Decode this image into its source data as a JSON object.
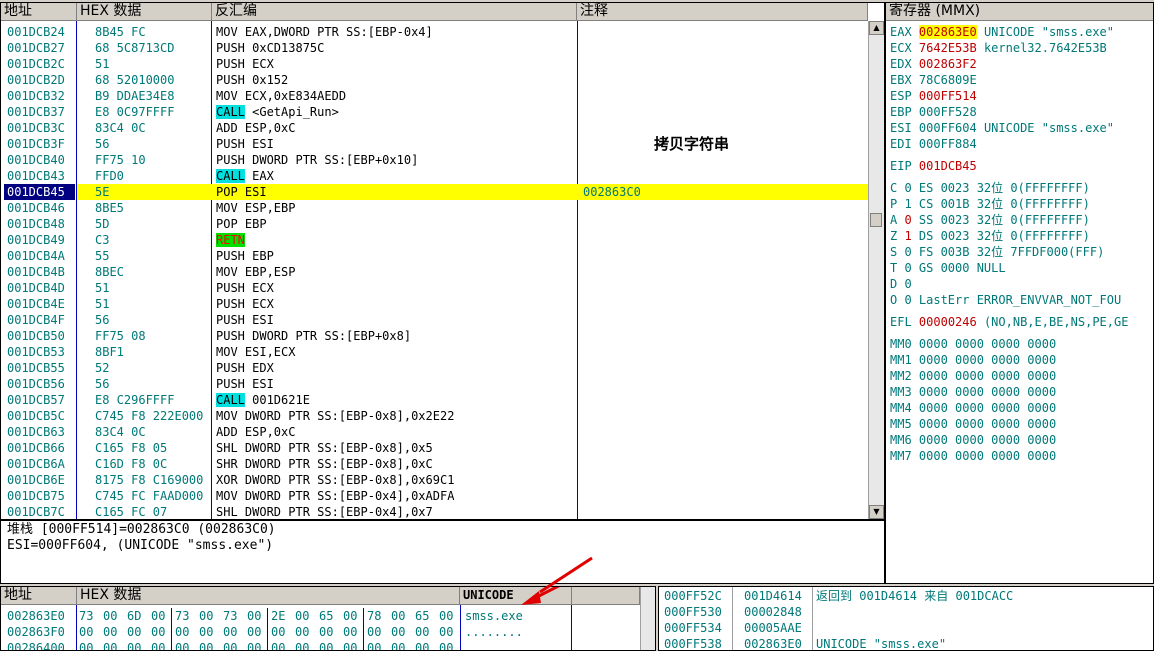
{
  "disasm": {
    "headers": {
      "address": "地址",
      "hex": "HEX 数据",
      "disasm": "反汇编",
      "comment": "注释"
    },
    "annotation": "拷贝字符串",
    "rows": [
      {
        "addr": "001DCB24",
        "hex": "8B45 FC",
        "asm": "MOV EAX,DWORD PTR SS:[EBP-0x4]",
        "comment": ""
      },
      {
        "addr": "001DCB27",
        "hex": "68 5C8713CD",
        "asm": "PUSH 0xCD13875C",
        "comment": ""
      },
      {
        "addr": "001DCB2C",
        "hex": "51",
        "asm": "PUSH ECX",
        "comment": ""
      },
      {
        "addr": "001DCB2D",
        "hex": "68 52010000",
        "asm": "PUSH 0x152",
        "comment": ""
      },
      {
        "addr": "001DCB32",
        "hex": "B9 DDAE34E8",
        "asm": "MOV ECX,0xE834AEDD",
        "comment": ""
      },
      {
        "addr": "001DCB37",
        "hex": "E8 0C97FFFF",
        "op": "CALL",
        "asm": " <GetApi_Run>",
        "kind": "call",
        "comment": ""
      },
      {
        "addr": "001DCB3C",
        "hex": "83C4 0C",
        "asm": "ADD ESP,0xC",
        "comment": ""
      },
      {
        "addr": "001DCB3F",
        "hex": "56",
        "asm": "PUSH ESI",
        "comment": ""
      },
      {
        "addr": "001DCB40",
        "hex": "FF75 10",
        "asm": "PUSH DWORD PTR SS:[EBP+0x10]",
        "comment": ""
      },
      {
        "addr": "001DCB43",
        "hex": "FFD0",
        "op": "CALL",
        "asm": " EAX",
        "kind": "call",
        "comment": ""
      },
      {
        "addr": "001DCB45",
        "hex": "5E",
        "asm": "POP ESI",
        "comment": "002863C0",
        "selected": true
      },
      {
        "addr": "001DCB46",
        "hex": "8BE5",
        "asm": "MOV ESP,EBP",
        "comment": ""
      },
      {
        "addr": "001DCB48",
        "hex": "5D",
        "asm": "POP EBP",
        "comment": ""
      },
      {
        "addr": "001DCB49",
        "hex": "C3",
        "op": "RETN",
        "asm": "",
        "kind": "retn",
        "comment": ""
      },
      {
        "addr": "001DCB4A",
        "hex": "55",
        "asm": "PUSH EBP",
        "comment": ""
      },
      {
        "addr": "001DCB4B",
        "hex": "8BEC",
        "asm": "MOV EBP,ESP",
        "comment": ""
      },
      {
        "addr": "001DCB4D",
        "hex": "51",
        "asm": "PUSH ECX",
        "comment": ""
      },
      {
        "addr": "001DCB4E",
        "hex": "51",
        "asm": "PUSH ECX",
        "comment": ""
      },
      {
        "addr": "001DCB4F",
        "hex": "56",
        "asm": "PUSH ESI",
        "comment": ""
      },
      {
        "addr": "001DCB50",
        "hex": "FF75 08",
        "asm": "PUSH DWORD PTR SS:[EBP+0x8]",
        "comment": ""
      },
      {
        "addr": "001DCB53",
        "hex": "8BF1",
        "asm": "MOV ESI,ECX",
        "comment": ""
      },
      {
        "addr": "001DCB55",
        "hex": "52",
        "asm": "PUSH EDX",
        "comment": ""
      },
      {
        "addr": "001DCB56",
        "hex": "56",
        "asm": "PUSH ESI",
        "comment": ""
      },
      {
        "addr": "001DCB57",
        "hex": "E8 C296FFFF",
        "op": "CALL",
        "asm": " 001D621E",
        "kind": "call",
        "comment": ""
      },
      {
        "addr": "001DCB5C",
        "hex": "C745 F8 222E000",
        "asm": "MOV DWORD PTR SS:[EBP-0x8],0x2E22",
        "comment": ""
      },
      {
        "addr": "001DCB63",
        "hex": "83C4 0C",
        "asm": "ADD ESP,0xC",
        "comment": ""
      },
      {
        "addr": "001DCB66",
        "hex": "C165 F8 05",
        "asm": "SHL DWORD PTR SS:[EBP-0x8],0x5",
        "comment": ""
      },
      {
        "addr": "001DCB6A",
        "hex": "C16D F8 0C",
        "asm": "SHR DWORD PTR SS:[EBP-0x8],0xC",
        "comment": ""
      },
      {
        "addr": "001DCB6E",
        "hex": "8175 F8 C169000",
        "asm": "XOR DWORD PTR SS:[EBP-0x8],0x69C1",
        "comment": ""
      },
      {
        "addr": "001DCB75",
        "hex": "C745 FC FAAD000",
        "asm": "MOV DWORD PTR SS:[EBP-0x4],0xADFA",
        "comment": ""
      },
      {
        "addr": "001DCB7C",
        "hex": "C165 FC 07",
        "asm": "SHL DWORD PTR SS:[EBP-0x4],0x7",
        "comment": ""
      }
    ]
  },
  "info": {
    "line1": "堆栈 [000FF514]=002863C0 (002863C0)",
    "line2": "ESI=000FF604, (UNICODE \"smss.exe\")"
  },
  "registers": {
    "title": "寄存器 (MMX)",
    "lines": [
      {
        "name": "EAX",
        "val": "002863E0",
        "rest": "UNICODE \"smss.exe\"",
        "hl": true
      },
      {
        "name": "ECX",
        "val": "7642E53B",
        "rest": "kernel32.7642E53B",
        "red": true
      },
      {
        "name": "EDX",
        "val": "002863F2",
        "rest": "",
        "red": true
      },
      {
        "name": "EBX",
        "val": "78C6809E",
        "rest": ""
      },
      {
        "name": "ESP",
        "val": "000FF514",
        "rest": "",
        "red": true
      },
      {
        "name": "EBP",
        "val": "000FF528",
        "rest": ""
      },
      {
        "name": "ESI",
        "val": "000FF604",
        "rest": "UNICODE \"smss.exe\""
      },
      {
        "name": "EDI",
        "val": "000FF884",
        "rest": ""
      },
      {
        "gap": true
      },
      {
        "name": "EIP",
        "val": "001DCB45",
        "rest": "",
        "red": true
      },
      {
        "gap": true
      },
      {
        "text": "C 0  ES 0023 32位  0(FFFFFFFF)"
      },
      {
        "text": "P 1  CS 001B 32位  0(FFFFFFFF)"
      },
      {
        "flag": "A",
        "fv": "0",
        "text": "  SS 0023 32位  0(FFFFFFFF)"
      },
      {
        "flag": "Z",
        "fv": "1",
        "text": "  DS 0023 32位  0(FFFFFFFF)"
      },
      {
        "text": "S 0  FS 003B 32位  7FFDF000(FFF)"
      },
      {
        "text": "T 0  GS 0000 NULL"
      },
      {
        "text": "D 0"
      },
      {
        "text": "O 0  LastErr ERROR_ENVVAR_NOT_FOU"
      },
      {
        "gap": true
      },
      {
        "name": "EFL",
        "val": "00000246",
        "rest": "(NO,NB,E,BE,NS,PE,GE",
        "red": true
      },
      {
        "gap": true
      },
      {
        "text": "MM0 0000 0000 0000 0000"
      },
      {
        "text": "MM1 0000 0000 0000 0000"
      },
      {
        "text": "MM2 0000 0000 0000 0000"
      },
      {
        "text": "MM3 0000 0000 0000 0000"
      },
      {
        "text": "MM4 0000 0000 0000 0000"
      },
      {
        "text": "MM5 0000 0000 0000 0000"
      },
      {
        "text": "MM6 0000 0000 0000 0000"
      },
      {
        "text": "MM7 0000 0000 0000 0000"
      }
    ]
  },
  "dump": {
    "headers": {
      "address": "地址",
      "hex": "HEX 数据",
      "unicode": "UNICODE"
    },
    "rows": [
      {
        "addr": "002863E0",
        "bytes": [
          "73",
          "00",
          "6D",
          "00",
          "73",
          "00",
          "73",
          "00",
          "2E",
          "00",
          "65",
          "00",
          "78",
          "00",
          "65",
          "00"
        ],
        "text": "smss.exe"
      },
      {
        "addr": "002863F0",
        "bytes": [
          "00",
          "00",
          "00",
          "00",
          "00",
          "00",
          "00",
          "00",
          "00",
          "00",
          "00",
          "00",
          "00",
          "00",
          "00",
          "00"
        ],
        "text": "........"
      },
      {
        "addr": "00286400",
        "bytes": [
          "00",
          "00",
          "00",
          "00",
          "00",
          "00",
          "00",
          "00",
          "00",
          "00",
          "00",
          "00",
          "00",
          "00",
          "00",
          "00"
        ],
        "text": ""
      }
    ]
  },
  "stack": {
    "rows": [
      {
        "addr": "000FF52C",
        "val": "001D4614",
        "comment": "返回到 001D4614 来自 001DCACC"
      },
      {
        "addr": "000FF530",
        "val": "00002848",
        "comment": ""
      },
      {
        "addr": "000FF534",
        "val": "00005AAE",
        "comment": ""
      },
      {
        "addr": "000FF538",
        "val": "002863E0",
        "comment": "UNICODE \"smss.exe\""
      }
    ]
  }
}
